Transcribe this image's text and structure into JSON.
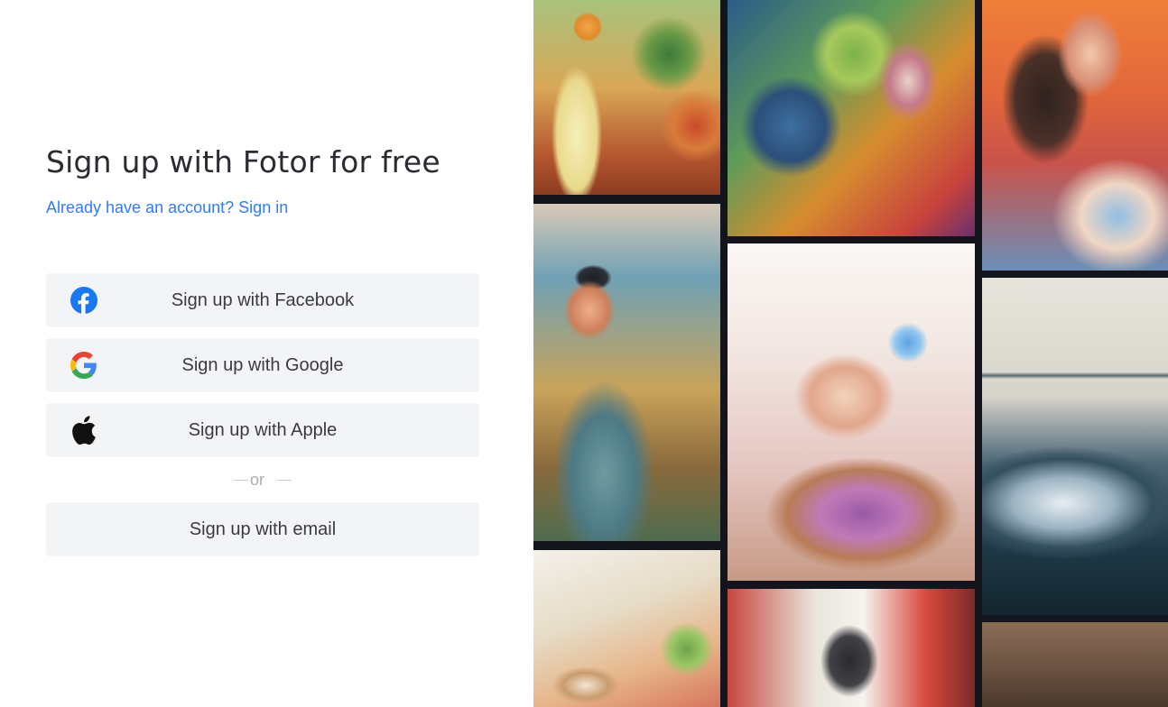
{
  "signup": {
    "heading": "Sign up with Fotor for free",
    "already_have_account": "Already have an account?",
    "sign_in_link": "Sign in",
    "facebook_label": "Sign up with Facebook",
    "google_label": "Sign up with Google",
    "apple_label": "Sign up with Apple",
    "divider_text": "or",
    "email_label": "Sign up with email"
  },
  "icons": {
    "facebook": "facebook-icon",
    "google": "google-icon",
    "apple": "apple-icon"
  },
  "colors": {
    "link": "#2f7df6",
    "button_bg": "#f3f4f6",
    "heading": "#2b2c32",
    "facebook_blue": "#1877f2"
  }
}
